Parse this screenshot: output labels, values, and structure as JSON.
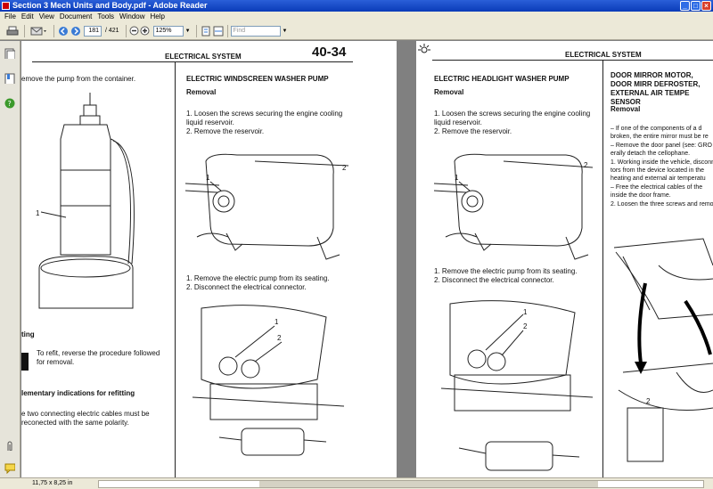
{
  "window": {
    "title": "Section 3 Mech Units and Body.pdf - Adobe Reader"
  },
  "menu": [
    "File",
    "Edit",
    "View",
    "Document",
    "Tools",
    "Window",
    "Help"
  ],
  "toolbar": {
    "page_current": "181",
    "page_total": "/ 421",
    "zoom": "125%",
    "find_placeholder": "Find"
  },
  "status": {
    "page_size": "11,75 x 8,25 in"
  },
  "page_left": {
    "header": "ELECTRICAL SYSTEM",
    "page_number": "40-34",
    "col1": {
      "intro": "emove the pump from the container.",
      "callout_1": "1",
      "refit_heading": "ting",
      "refit_text": "To refit, reverse the procedure followed for removal.",
      "supp_heading": "lementary indications for refitting",
      "supp_text": "e two connecting electric cables must be reconected with the same polarity."
    },
    "col2": {
      "title": "ELECTRIC WINDSCREEN WASHER PUMP",
      "subtitle": "Removal",
      "steps_a": [
        "1.  Loosen the screws securing the engine cooling liquid reservoir.",
        "2.  Remove the reservoir."
      ],
      "steps_b": [
        "1.  Remove the electric pump from its seating.",
        "2.  Disconnect the electrical connector."
      ],
      "callouts": [
        "1",
        "2",
        "1",
        "2"
      ]
    }
  },
  "page_right": {
    "header": "ELECTRICAL SYSTEM",
    "col1": {
      "title": "ELECTRIC HEADLIGHT WASHER PUMP",
      "subtitle": "Removal",
      "steps_a": [
        "1.  Loosen the screws securing the engine cooling liquid reservoir.",
        "2.  Remove the reservoir."
      ],
      "steps_b": [
        "1.  Remove the electric pump from its seating.",
        "2.  Disconnect the electrical connector."
      ],
      "callouts": [
        "1",
        "2",
        "1",
        "2"
      ]
    },
    "col2": {
      "title": "DOOR MIRROR MOTOR, DOOR MIRR DEFROSTER, EXTERNAL AIR TEMPE SENSOR",
      "subtitle": "Removal",
      "bullets": [
        "–  If one of the components of a d broken, the entire mirror must be re",
        "–  Remove the door panel (see: GRO erally detach the cellophane.",
        "1.  Working inside the vehicle, disconn tors from the device located in the heating and external air temperatu",
        "–  Free the electrical cables of the inside the door frame.",
        "2.  Loosen the three screws and remo"
      ],
      "callout_2": "2"
    }
  }
}
